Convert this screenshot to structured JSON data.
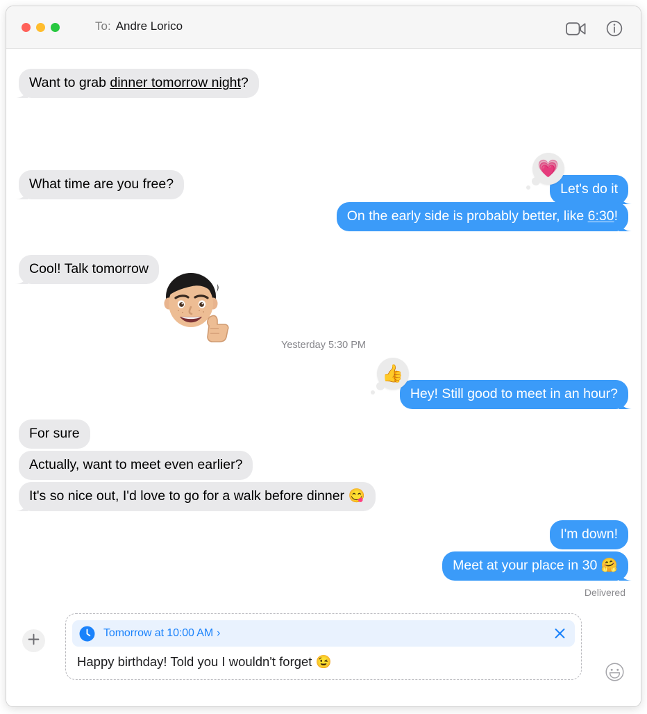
{
  "window": {
    "traffic_lights": [
      {
        "name": "close",
        "color": "#ff6159"
      },
      {
        "name": "minimize",
        "color": "#ffbd2e"
      },
      {
        "name": "zoom",
        "color": "#28c840"
      }
    ]
  },
  "titlebar": {
    "to_label": "To:",
    "recipient": "Andre Lorico",
    "facetime_icon": "video-camera-icon",
    "details_icon": "info-circle-icon"
  },
  "conversation": {
    "divider": "Yesterday 5:30 PM",
    "delivered_status": "Delivered",
    "messages": [
      {
        "id": "m1",
        "direction": "incoming",
        "text_before": "Want to grab ",
        "link": "dinner tomorrow night",
        "text_after": "?",
        "tail": true
      },
      {
        "id": "m2",
        "direction": "outgoing",
        "text": "Let's do it",
        "tapback": "💗",
        "tapback_name": "heart-tapback",
        "tail": true
      },
      {
        "id": "m3",
        "direction": "incoming",
        "text": "What time are you free?",
        "tail": true
      },
      {
        "id": "m4",
        "direction": "outgoing",
        "text_before": "On the early side is probably better, like ",
        "link": "6:30",
        "text_after": "!",
        "tail": true
      },
      {
        "id": "m5",
        "direction": "incoming",
        "text": "Cool! Talk tomorrow",
        "sticker": "memoji-thumbs-up-sticker",
        "tail": true
      },
      {
        "id": "m6",
        "direction": "outgoing",
        "text": "Hey! Still good to meet in an hour?",
        "tapback": "👍",
        "tapback_name": "thumbs-up-tapback",
        "tail": true
      },
      {
        "id": "m7",
        "direction": "incoming",
        "text": "For sure",
        "tail": false
      },
      {
        "id": "m8",
        "direction": "incoming",
        "text": "Actually, want to meet even earlier?",
        "tail": false
      },
      {
        "id": "m9",
        "direction": "incoming",
        "text": "It's so nice out, I'd love to go for a walk before dinner 😋",
        "tail": true
      },
      {
        "id": "m10",
        "direction": "outgoing",
        "text": "I'm down!",
        "tail": false
      },
      {
        "id": "m11",
        "direction": "outgoing",
        "text": "Meet at your place in 30 🤗",
        "tail": true
      }
    ]
  },
  "compose": {
    "plus_icon": "plus-icon",
    "schedule": {
      "clock_icon": "clock-icon",
      "label": "Tomorrow at 10:00 AM",
      "chevron": "›",
      "close_icon": "close-icon"
    },
    "draft_text": "Happy birthday! Told you I wouldn't forget 😉",
    "emoji_icon": "emoji-smiley-icon"
  },
  "colors": {
    "outgoing_bubble": "#3b9bf9",
    "incoming_bubble": "#e9e9eb",
    "accent_blue": "#1a82fb",
    "banner_bg": "#e9f2fe"
  }
}
